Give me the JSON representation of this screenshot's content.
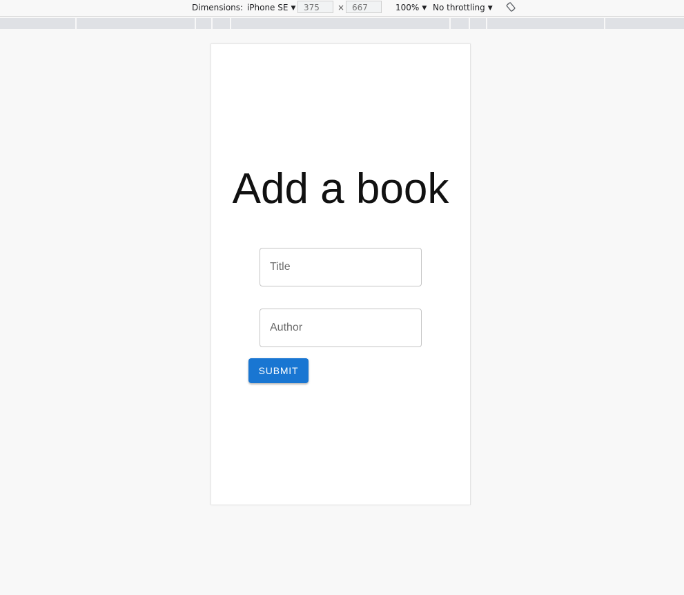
{
  "devtools": {
    "dimensions_prefix": "Dimensions:",
    "device_name": "iPhone SE",
    "width_value": "375",
    "times": "×",
    "height_value": "667",
    "zoom": "100%",
    "throttling": "No throttling"
  },
  "page": {
    "title": "Add a book",
    "title_field_placeholder": "Title",
    "author_field_placeholder": "Author",
    "submit_label": "SUBMIT"
  },
  "colors": {
    "primary": "#1976d2",
    "page_background": "#f8f8f8",
    "media_bar": "#dfe1e5"
  },
  "icons": {
    "rotate": "rotate-icon",
    "dropdown": "dropdown-arrow-icon"
  }
}
